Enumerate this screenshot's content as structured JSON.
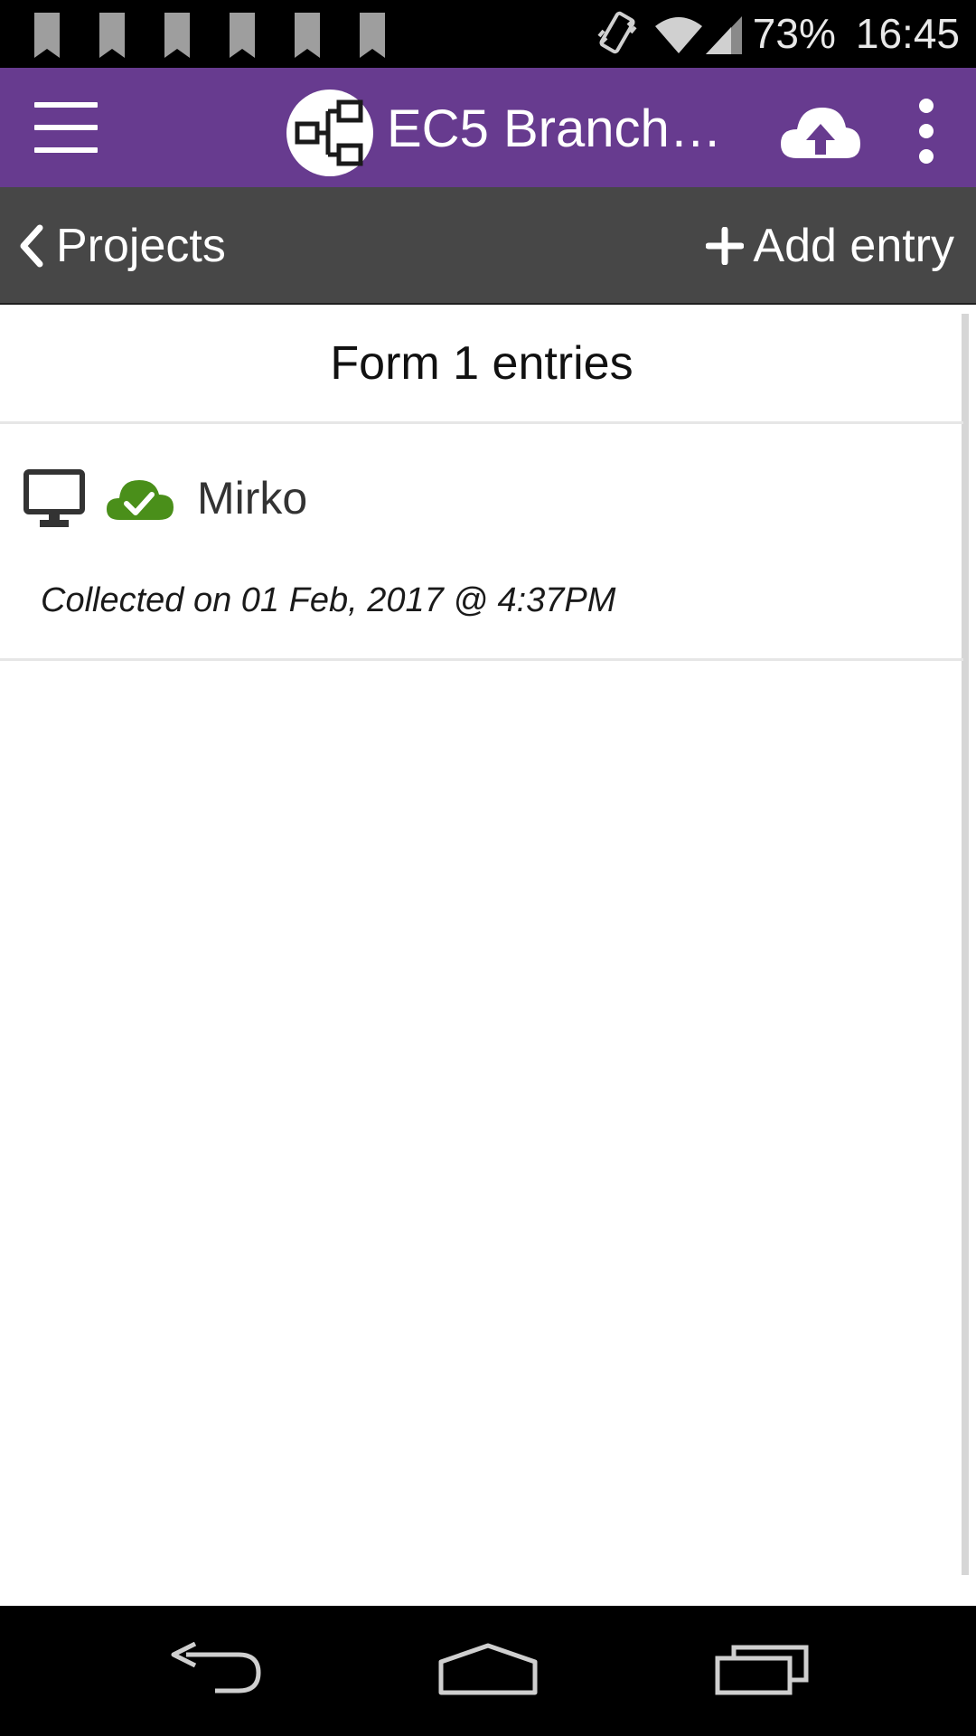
{
  "status_bar": {
    "battery": "73%",
    "time": "16:45",
    "icons": [
      "bookmark-icon",
      "vibrate-icon",
      "wifi-icon",
      "signal-icon"
    ]
  },
  "app_bar": {
    "title": "EC5 Branch…",
    "background_color": "#673b8f",
    "icons": [
      "menu-icon",
      "project-logo-icon",
      "cloud-upload-icon",
      "more-vert-icon"
    ]
  },
  "nav_bar": {
    "back_label": "Projects",
    "add_label": "Add entry",
    "background_color": "#474747"
  },
  "list": {
    "header": "Form 1 entries",
    "entries": [
      {
        "title": "Mirko",
        "collected": "Collected on 01 Feb, 2017 @ 4:37PM",
        "device_icon": "desktop-icon",
        "status_icon": "cloud-check-icon",
        "status_color": "#4a8f1a"
      }
    ]
  },
  "system_nav": {
    "icons": [
      "back-icon",
      "home-icon",
      "recents-icon"
    ]
  }
}
